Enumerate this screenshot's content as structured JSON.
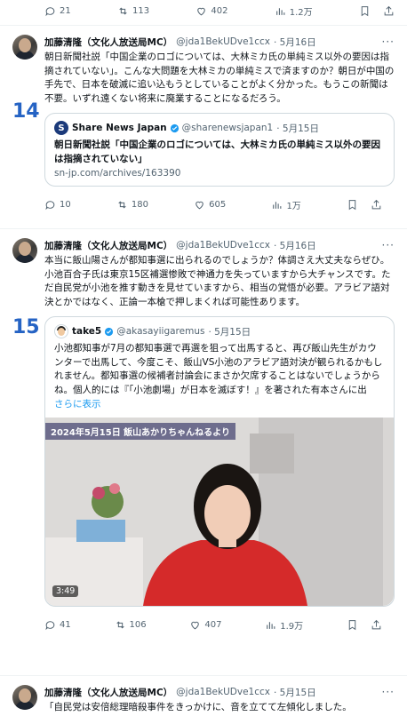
{
  "top_actions": {
    "replies": "21",
    "retweets": "113",
    "likes": "402",
    "views": "1.2万"
  },
  "tweet14": {
    "number": "14",
    "name": "加藤清隆（文化人放送局MC）",
    "handle": "@jda1BekUDve1ccx",
    "date": "· 5月16日",
    "text": "朝日新聞社説「中国企業のロゴについては、大林ミカ氏の単純ミス以外の要因は指摘されていない」。こんな大問題を大林ミカの単純ミスで済ますのか？朝日が中国の手先で、日本を破滅に追い込もうとしていることがよく分かった。もうこの新聞は不要。いずれ遠くない将来に廃業することになるだろう。",
    "card": {
      "logo": "S",
      "source": "Share News Japan",
      "handle": "@sharenewsjapan1",
      "date": "· 5月15日",
      "title": "朝日新聞社説「中国企業のロゴについては、大林ミカ氏の単純ミス以外の要因は指摘されていない」",
      "link": "sn-jp.com/archives/163390"
    },
    "actions": {
      "replies": "10",
      "retweets": "180",
      "likes": "605",
      "views": "1万"
    }
  },
  "tweet15": {
    "number": "15",
    "name": "加藤清隆（文化人放送局MC）",
    "handle": "@jda1BekUDve1ccx",
    "date": "· 5月16日",
    "text": "本当に飯山陽さんが都知事選に出られるのでしょうか？体調さえ大丈夫ならぜひ。小池百合子氏は東京15区補選惨敗で神通力を失っていますから大チャンスです。ただ自民党が小池を推す動きを見せていますから、相当の覚悟が必要。アラビア語対決とかではなく、正論一本槍で押しまくれば可能性あります。",
    "quote": {
      "name": "take5",
      "handle": "@akasayiigaremus",
      "date": "· 5月15日",
      "text": "小池都知事が7月の都知事選で再選を狙って出馬すると、再び飯山先生がカウンターで出馬して、今度こそ、飯山VS小池のアラビア語対決が観られるかもしれません。都知事選の候補者討論会にまさか欠席することはないでしょうからね。個人的には『「小池劇場」が日本を滅ぼす！』を著された有本さんに出",
      "show_more": "さらに表示",
      "video_caption": "2024年5月15日 飯山あかりちゃんねるより",
      "video_time": "3:49"
    },
    "actions": {
      "replies": "41",
      "retweets": "106",
      "likes": "407",
      "views": "1.9万"
    }
  },
  "tweet16": {
    "name": "加藤清隆（文化人放送局MC）",
    "handle": "@jda1BekUDve1ccx",
    "date": "· 5月15日",
    "text": "「自民党は安倍総理暗殺事件をきっかけに、音を立てて左傾化しました。"
  }
}
